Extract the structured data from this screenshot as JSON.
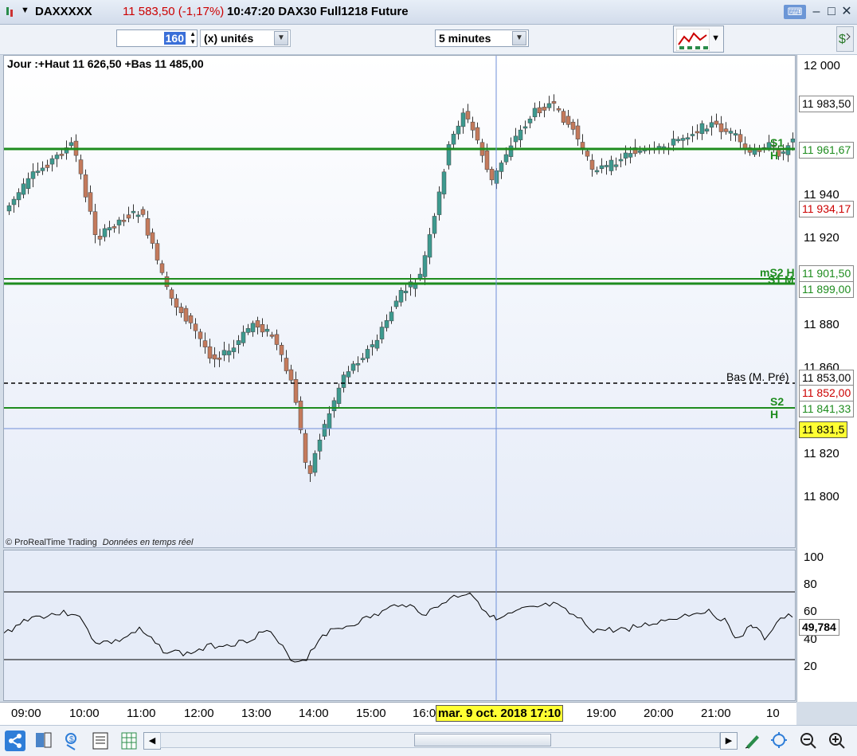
{
  "title": {
    "symbol": "DAXXXXX",
    "price_change": "11 583,50 (-1,17%)",
    "time_info": "10:47:20 DAX30 Full1218 Future"
  },
  "toolbar": {
    "units_value": "160",
    "units_label": "(x) unités",
    "timeframe": "5 minutes"
  },
  "chart": {
    "header": "Jour :+Haut 11 626,50 +Bas 11 485,00",
    "watermark_brand": "© ProRealTime Trading",
    "watermark_note": "Données en temps réel",
    "crosshair_date": "mar. 9 oct. 2018 17:10"
  },
  "price_axis": {
    "ticks": [
      "12 000",
      "11 960",
      "11 940",
      "11 920",
      "11 880",
      "11 860",
      "11 820",
      "11 800"
    ]
  },
  "levels": {
    "s1h_label": "S1 H",
    "s1h_value": "11 961,67",
    "ms2h_label": "mS2 H",
    "s1m_label": "S1 M",
    "ms2h_value": "11 901,50",
    "s1m_value": "11 899,00",
    "bas_label": "Bas (M. Pré)",
    "bas_value": "11 853,00",
    "s2h_label": "S2 H",
    "s2h_value": "11 841,33",
    "last_value": "11 983,50",
    "red_value": "11 934,17",
    "red_value2": "11 852,00",
    "cursor_value": "11 831,5"
  },
  "osc_axis": {
    "ticks": [
      "100",
      "80",
      "60",
      "40",
      "20"
    ],
    "value": "49,784"
  },
  "time_axis": {
    "ticks": [
      "09:00",
      "10:00",
      "11:00",
      "12:00",
      "13:00",
      "14:00",
      "15:00",
      "16:0",
      "19:00",
      "20:00",
      "21:00",
      "10"
    ]
  },
  "colors": {
    "bull": "#3d9a8f",
    "bear": "#c47a5c",
    "level_green": "#1e8c1e",
    "crosshair": "#6f8fd8",
    "negative": "#cc0000"
  }
}
